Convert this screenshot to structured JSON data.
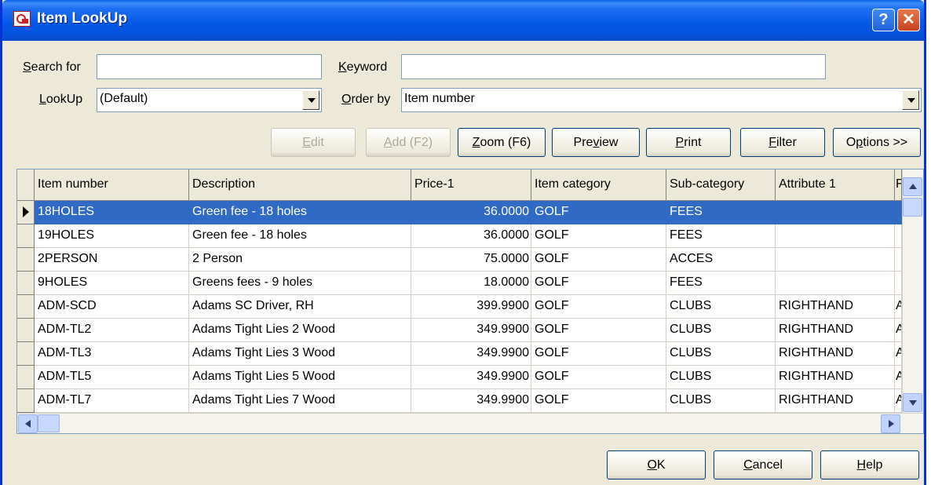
{
  "window": {
    "title": "Item LookUp"
  },
  "titlebar": {
    "help_glyph": "?",
    "close_glyph": "✕"
  },
  "form": {
    "search_for_label_u": "S",
    "search_for_label_rest": "earch for",
    "search_for_value": "",
    "keyword_label_u": "K",
    "keyword_label_rest": "eyword",
    "keyword_value": "",
    "lookup_label_u": "L",
    "lookup_label_rest": "ookUp",
    "lookup_value": "(Default)",
    "order_by_label_u": "O",
    "order_by_label_rest": "rder by",
    "order_by_value": "Item number"
  },
  "toolbar": {
    "edit_u": "E",
    "edit_rest": "dit",
    "add_u": "A",
    "add_rest": "dd (F2)",
    "zoom_u": "Z",
    "zoom_rest": "oom (F6)",
    "preview_pre": "Pre",
    "preview_u": "v",
    "preview_rest": "iew",
    "print_u": "P",
    "print_rest": "rint",
    "filter_u": "F",
    "filter_rest": "ilter",
    "options_pre": "O",
    "options_u": "p",
    "options_rest": "tions >>"
  },
  "grid": {
    "columns": [
      "Item number",
      "Description",
      "Price-1",
      "Item category",
      "Sub-category",
      "Attribute 1",
      "F"
    ],
    "rows": [
      [
        "18HOLES",
        "Green fee - 18 holes",
        "36.0000",
        "GOLF",
        "FEES",
        "",
        ""
      ],
      [
        "19HOLES",
        "Green fee - 18 holes",
        "36.0000",
        "GOLF",
        "FEES",
        "",
        ""
      ],
      [
        "2PERSON",
        "2 Person",
        "75.0000",
        "GOLF",
        "ACCES",
        "",
        ""
      ],
      [
        "9HOLES",
        "Greens fees - 9 holes",
        "18.0000",
        "GOLF",
        "FEES",
        "",
        ""
      ],
      [
        "ADM-SCD",
        "Adams SC Driver, RH",
        "399.9900",
        "GOLF",
        "CLUBS",
        "RIGHTHAND",
        "A"
      ],
      [
        "ADM-TL2",
        "Adams Tight Lies 2 Wood",
        "349.9900",
        "GOLF",
        "CLUBS",
        "RIGHTHAND",
        "A"
      ],
      [
        "ADM-TL3",
        "Adams Tight Lies 3 Wood",
        "349.9900",
        "GOLF",
        "CLUBS",
        "RIGHTHAND",
        "A"
      ],
      [
        "ADM-TL5",
        "Adams Tight Lies 5 Wood",
        "349.9900",
        "GOLF",
        "CLUBS",
        "RIGHTHAND",
        "A"
      ],
      [
        "ADM-TL7",
        "Adams Tight Lies 7 Wood",
        "349.9900",
        "GOLF",
        "CLUBS",
        "RIGHTHAND",
        "A"
      ]
    ],
    "selected_row": 0
  },
  "footer": {
    "ok_u": "O",
    "ok_rest": "K",
    "cancel_u": "C",
    "cancel_rest": "ancel",
    "help_u": "H",
    "help_rest": "elp"
  },
  "colors": {
    "selection": "#316ac5",
    "titlebar": "#0058e6",
    "face": "#ece9d8"
  }
}
